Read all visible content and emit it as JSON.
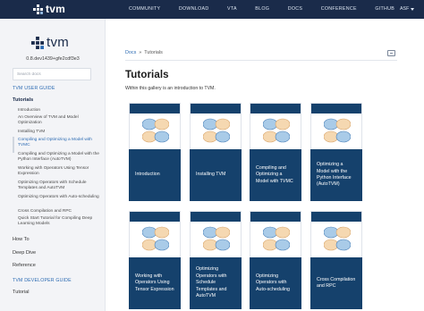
{
  "topnav": {
    "brand": "tvm",
    "links": [
      "COMMUNITY",
      "DOWNLOAD",
      "VTA",
      "BLOG",
      "DOCS",
      "CONFERENCE",
      "GITHUB"
    ],
    "asf": "ASF"
  },
  "sidebar": {
    "brand": "tvm",
    "version": "0.8.dev1439+gfe2cdf3e3",
    "search_placeholder": "Search docs",
    "user_guide_caption": "TVM USER GUIDE",
    "tutorials_label": "Tutorials",
    "tutorial_items": [
      "Introduction",
      "An Overview of TVM and Model Optimization",
      "Installing TVM",
      "Compiling and Optimizing a Model with TVMC",
      "Compiling and Optimizing a Model with the Python Interface (AutoTVM)",
      "Working with Operators Using Tensor Expression",
      "Optimizing Operators with Schedule Templates and AutoTVM",
      "Optimizing Operators with Auto-scheduling",
      "Cross Compilation and RPC",
      "Quick Start Tutorial for Compiling Deep Learning Models"
    ],
    "how_to": "How To",
    "deep_dive": "Deep Dive",
    "reference": "Reference",
    "dev_guide_caption": "TVM DEVELOPER GUIDE",
    "dev_tutorial": "Tutorial"
  },
  "breadcrumb": {
    "docs": "Docs",
    "sep": "»",
    "current": "Tutorials"
  },
  "page": {
    "title": "Tutorials",
    "intro": "Within this gallery is an introduction to TVM."
  },
  "gallery": [
    "Introduction",
    "Installing TVM",
    "Compiling and Optimizing a Model with TVMC",
    "Optimizing a Model with the Python Interface (AutoTVM)",
    "Working with Operators Using Tensor Expression",
    "Optimizing Operators with Schedule Templates and AutoTVM",
    "Optimizing Operators with Auto-scheduling",
    "Cross Compilation and RPC"
  ],
  "colors": {
    "navbar": "#1a2b4a",
    "card_caption": "#15416c",
    "link": "#2c6bb3",
    "blob_blue": "#a9cbe8",
    "blob_peach": "#f5d8b1"
  }
}
